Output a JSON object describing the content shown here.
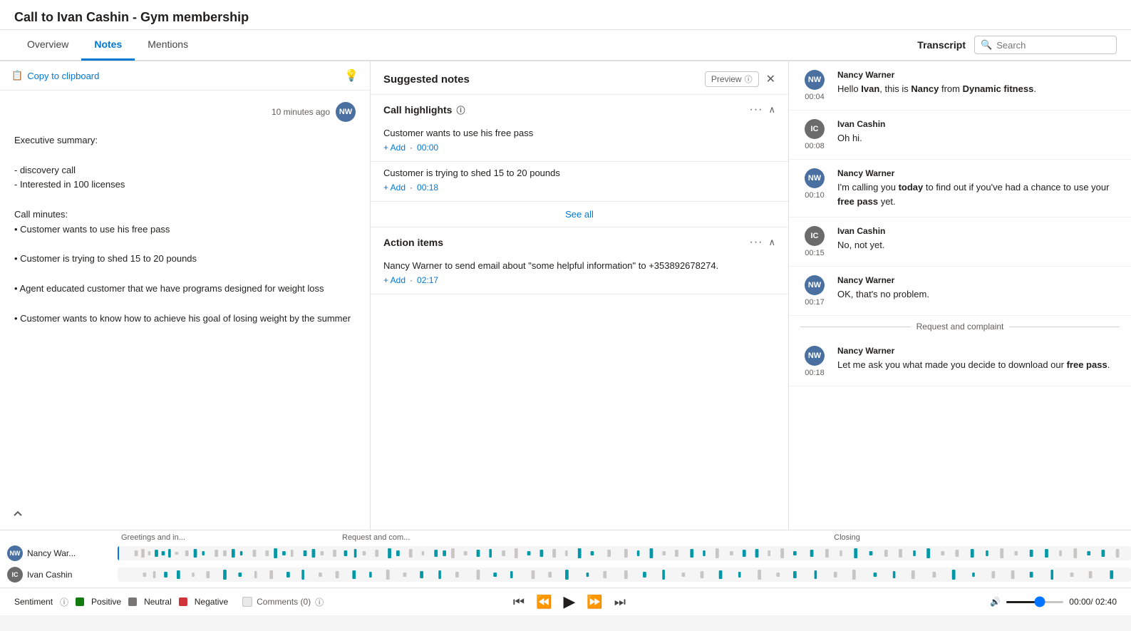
{
  "title": "Call to Ivan Cashin - Gym membership",
  "tabs": [
    {
      "id": "overview",
      "label": "Overview",
      "active": false
    },
    {
      "id": "notes",
      "label": "Notes",
      "active": true
    },
    {
      "id": "mentions",
      "label": "Mentions",
      "active": false
    }
  ],
  "transcript": {
    "label": "Transcript",
    "search_placeholder": "Search"
  },
  "toolbar": {
    "copy_label": "Copy to clipboard",
    "bulb_icon": "💡"
  },
  "notes_panel": {
    "timestamp": "10 minutes ago",
    "avatar_initials": "NW",
    "content": "Executive summary:\n\n- discovery call\n- Interested in 100 licenses\n\nCall minutes:\n• Customer wants to use his free pass\n\n• Customer is trying to shed 15 to 20 pounds\n\n• Agent educated customer that we have programs designed for weight loss\n\n• Customer wants to know how to achieve his goal of losing weight by the summer"
  },
  "suggested_notes": {
    "title": "Suggested notes",
    "preview_label": "Preview",
    "sections": {
      "highlights": {
        "title": "Call highlights",
        "items": [
          {
            "text": "Customer wants to use his free pass",
            "timestamp": "00:00"
          },
          {
            "text": "Customer is trying to shed 15 to 20 pounds",
            "timestamp": "00:18"
          }
        ],
        "see_all": "See all"
      },
      "action_items": {
        "title": "Action items",
        "items": [
          {
            "text": "Nancy Warner to send email about \"some helpful information\" to +353892678274.",
            "timestamp": "02:17"
          }
        ]
      }
    },
    "add_label": "+ Add"
  },
  "transcript_entries": [
    {
      "speaker": "Nancy Warner",
      "avatar_initials": "NW",
      "avatar_color": "nw",
      "time": "00:04",
      "html_text": "Hello <strong>Ivan</strong>, this is <strong>Nancy</strong> from <strong>Dynamic fitness</strong>."
    },
    {
      "speaker": "Ivan Cashin",
      "avatar_initials": "IC",
      "avatar_color": "ic",
      "time": "00:08",
      "html_text": "Oh hi."
    },
    {
      "speaker": "Nancy Warner",
      "avatar_initials": "NW",
      "avatar_color": "nw",
      "time": "00:10",
      "html_text": "I'm calling you <strong>today</strong> to find out if you've had a chance to use your <strong>free pass</strong> yet."
    },
    {
      "speaker": "Ivan Cashin",
      "avatar_initials": "IC",
      "avatar_color": "ic",
      "time": "00:15",
      "html_text": "No, not yet."
    },
    {
      "speaker": "Nancy Warner",
      "avatar_initials": "NW",
      "avatar_color": "nw",
      "time": "00:17",
      "html_text": "OK, that's no problem."
    },
    {
      "section_divider": "Request and complaint"
    },
    {
      "speaker": "Nancy Warner",
      "avatar_initials": "NW",
      "avatar_color": "nw",
      "time": "00:18",
      "html_text": "Let me ask you what made you decide to download our <strong>free pass</strong>."
    }
  ],
  "waveform": {
    "segments": [
      {
        "label": "Greetings and in...",
        "position": 0
      },
      {
        "label": "Request and com...",
        "position": 1
      },
      {
        "label": "Closing",
        "position": 2
      }
    ],
    "tracks": [
      {
        "name": "Nancy War...",
        "avatar_initials": "NW",
        "avatar_color": "nw"
      },
      {
        "name": "Ivan Cashin",
        "avatar_initials": "IC",
        "avatar_color": "ic"
      }
    ],
    "playhead_time": "00:00"
  },
  "controls": {
    "sentiment_label": "Sentiment",
    "positive_label": "Positive",
    "neutral_label": "Neutral",
    "negative_label": "Negative",
    "comments_label": "Comments (0)",
    "current_time": "00:00",
    "total_time": "02:40"
  }
}
